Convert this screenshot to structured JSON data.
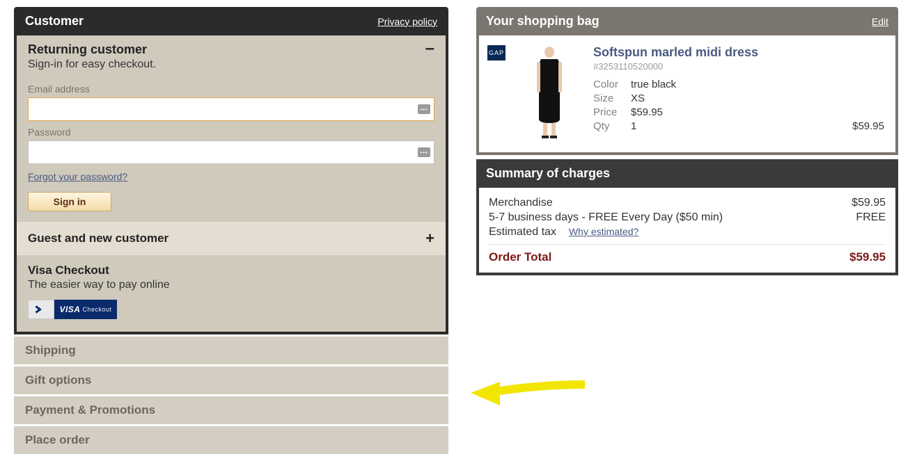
{
  "left": {
    "header_title": "Customer",
    "privacy": "Privacy policy",
    "returning": {
      "title": "Returning customer",
      "subtitle": "Sign-in for easy checkout.",
      "email_label": "Email address",
      "password_label": "Password",
      "forgot": "Forgot your password?",
      "signin": "Sign in",
      "toggle": "–"
    },
    "guest": {
      "title": "Guest and new customer",
      "toggle": "+"
    },
    "visa": {
      "title": "Visa Checkout",
      "subtitle": "The easier way to pay online",
      "logo_main": "VISA",
      "logo_sub": "Checkout"
    },
    "steps": [
      "Shipping",
      "Gift options",
      "Payment & Promotions",
      "Place order"
    ]
  },
  "bag": {
    "header": "Your shopping bag",
    "edit": "Edit",
    "brand": "GAP",
    "product_name": "Softspun marled midi dress",
    "sku": "#3253110520000",
    "attrs": {
      "color_k": "Color",
      "color_v": "true black",
      "size_k": "Size",
      "size_v": "XS",
      "price_k": "Price",
      "price_v": "$59.95",
      "qty_k": "Qty",
      "qty_v": "1",
      "line_total": "$59.95"
    }
  },
  "summary": {
    "header": "Summary of charges",
    "merch_lbl": "Merchandise",
    "merch_val": "$59.95",
    "ship_lbl": "5-7 business days - FREE Every Day ($50 min)",
    "ship_val": "FREE",
    "tax_lbl": "Estimated tax",
    "tax_link": "Why estimated?",
    "total_lbl": "Order Total",
    "total_val": "$59.95"
  }
}
